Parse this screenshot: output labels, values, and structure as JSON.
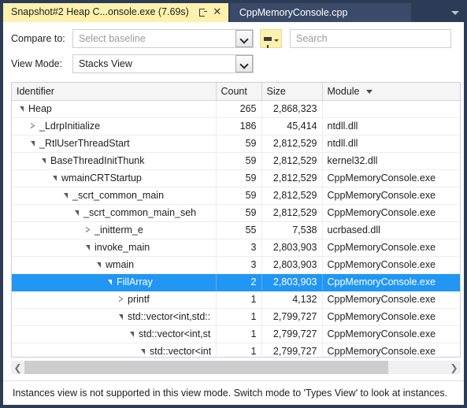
{
  "window": {
    "tabs": [
      {
        "title": "Snapshot#2 Heap C...onsole.exe (7.69s)",
        "active": true,
        "pin_icon": "pin-icon",
        "close_icon": "close-icon"
      },
      {
        "title": "CppMemoryConsole.cpp",
        "active": false
      }
    ],
    "overflow_icon": "chevron-down-icon"
  },
  "toolbar": {
    "compare_label": "Compare to:",
    "compare_placeholder": "Select baseline",
    "compare_value": "",
    "viewmode_label": "View Mode:",
    "viewmode_value": "Stacks View",
    "filter_icon": "filter-funnel-icon",
    "search_placeholder": "Search",
    "search_value": ""
  },
  "grid": {
    "columns": [
      {
        "key": "identifier",
        "label": "Identifier",
        "sorted": false
      },
      {
        "key": "count",
        "label": "Count",
        "sorted": false
      },
      {
        "key": "size",
        "label": "Size",
        "sorted": false
      },
      {
        "key": "module",
        "label": "Module",
        "sorted": true,
        "sort_icon": "sort-descending-caret-icon"
      }
    ],
    "rows": [
      {
        "identifier": "Heap",
        "depth": 0,
        "state": "expanded",
        "count": "265",
        "size": "2,868,323",
        "module": "",
        "selected": false
      },
      {
        "identifier": "_LdrpInitialize",
        "depth": 1,
        "state": "collapsed",
        "count": "186",
        "size": "45,414",
        "module": "ntdll.dll",
        "selected": false
      },
      {
        "identifier": "_RtlUserThreadStart",
        "depth": 1,
        "state": "expanded",
        "count": "59",
        "size": "2,812,529",
        "module": "ntdll.dll",
        "selected": false
      },
      {
        "identifier": "BaseThreadInitThunk",
        "depth": 2,
        "state": "expanded",
        "count": "59",
        "size": "2,812,529",
        "module": "kernel32.dll",
        "selected": false
      },
      {
        "identifier": "wmainCRTStartup",
        "depth": 3,
        "state": "expanded",
        "count": "59",
        "size": "2,812,529",
        "module": "CppMemoryConsole.exe",
        "selected": false
      },
      {
        "identifier": "_scrt_common_main",
        "depth": 4,
        "state": "expanded",
        "count": "59",
        "size": "2,812,529",
        "module": "CppMemoryConsole.exe",
        "selected": false
      },
      {
        "identifier": "_scrt_common_main_seh",
        "depth": 5,
        "state": "expanded",
        "count": "59",
        "size": "2,812,529",
        "module": "CppMemoryConsole.exe",
        "selected": false
      },
      {
        "identifier": "_initterm_e",
        "depth": 6,
        "state": "collapsed",
        "count": "55",
        "size": "7,538",
        "module": "ucrbased.dll",
        "selected": false
      },
      {
        "identifier": "invoke_main",
        "depth": 6,
        "state": "expanded",
        "count": "3",
        "size": "2,803,903",
        "module": "CppMemoryConsole.exe",
        "selected": false
      },
      {
        "identifier": "wmain",
        "depth": 7,
        "state": "expanded",
        "count": "3",
        "size": "2,803,903",
        "module": "CppMemoryConsole.exe",
        "selected": false
      },
      {
        "identifier": "FillArray",
        "depth": 8,
        "state": "expanded",
        "count": "2",
        "size": "2,803,903",
        "module": "CppMemoryConsole.exe",
        "selected": true
      },
      {
        "identifier": "printf",
        "depth": 9,
        "state": "collapsed",
        "count": "1",
        "size": "4,132",
        "module": "CppMemoryConsole.exe",
        "selected": false
      },
      {
        "identifier": "std::vector<int,std::alloc...",
        "depth": 9,
        "state": "expanded",
        "count": "1",
        "size": "2,799,727",
        "module": "CppMemoryConsole.exe",
        "selected": false
      },
      {
        "identifier": "std::vector<int,std::al...",
        "depth": 10,
        "state": "expanded",
        "count": "1",
        "size": "2,799,727",
        "module": "CppMemoryConsole.exe",
        "selected": false
      },
      {
        "identifier": "std::vector<int,st...",
        "depth": 11,
        "state": "expanded",
        "count": "1",
        "size": "2,799,727",
        "module": "CppMemoryConsole.exe",
        "selected": false
      }
    ]
  },
  "hscroll": {
    "left_icon": "chevron-left-icon",
    "right_icon": "chevron-right-icon"
  },
  "status": {
    "message": "Instances view is not supported in this view mode. Switch mode to 'Types View' to look at instances."
  },
  "colors": {
    "chrome": "#2d3c56",
    "active_tab": "#fdf1ad",
    "inactive_tab": "#3a4a68",
    "selection": "#2196f3",
    "grid_border": "#cccedb"
  }
}
